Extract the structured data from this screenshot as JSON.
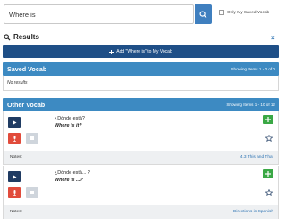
{
  "search": {
    "value": "Where is",
    "only_saved_label": "Only My Saved Vocab"
  },
  "results": {
    "title": "Results",
    "close": "×",
    "add_button": "Add \"Where is\" to My Vocab"
  },
  "saved_vocab": {
    "title": "Saved Vocab",
    "showing": "Showing Items 1 - 0 of 0",
    "empty_text": "No results"
  },
  "other_vocab": {
    "title": "Other Vocab",
    "showing": "Showing Items 1 - 10 of 12",
    "items": [
      {
        "spanish": "¿Dónde está?",
        "english": "Where is it?",
        "notes_label": "Notes:",
        "source": "4.3 This and That"
      },
      {
        "spanish": "¿Dónde está... ?",
        "english": "Where is ...?",
        "notes_label": "Notes:",
        "source": "Directions in Spanish"
      }
    ]
  },
  "colors": {
    "primary": "#3d8ac2",
    "dark_blue": "#1f4f87",
    "add_green": "#3aa845",
    "record_red": "#e14b3b",
    "link": "#2d73b3"
  }
}
